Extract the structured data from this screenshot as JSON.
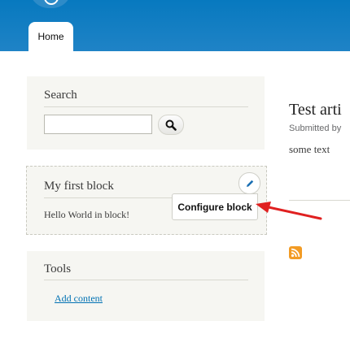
{
  "header": {
    "tab_home": "Home"
  },
  "sidebar": {
    "search": {
      "title": "Search"
    },
    "first_block": {
      "title": "My first block",
      "body": "Hello World in block!",
      "configure_label": "Configure block"
    },
    "tools": {
      "title": "Tools",
      "add_content": "Add content"
    }
  },
  "main": {
    "title": "Test arti",
    "submitted": "Submitted by",
    "body": "some text"
  },
  "colors": {
    "header_blue": "#0779bf",
    "link": "#0071b3",
    "arrow": "#e02020",
    "rss": "#f29b24"
  }
}
